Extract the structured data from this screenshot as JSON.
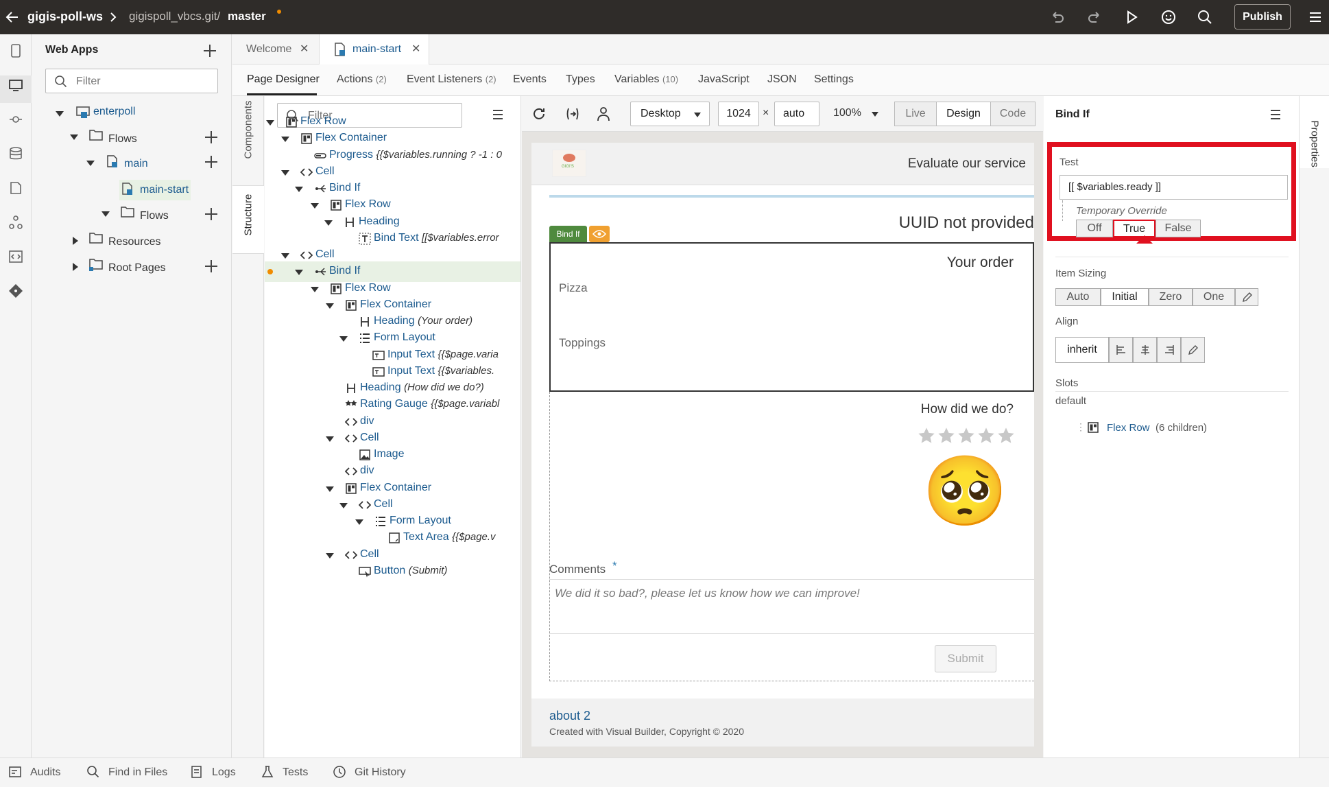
{
  "topbar": {
    "app_name": "gigis-poll-ws",
    "repo": "gigispoll_vbcs.git/",
    "branch": "master",
    "publish": "Publish"
  },
  "apps_panel": {
    "title": "Web Apps",
    "filter_placeholder": "Filter",
    "nodes": {
      "app": "enterpoll",
      "flows": "Flows",
      "main": "main",
      "main_start": "main-start",
      "subflows": "Flows",
      "resources": "Resources",
      "root_pages": "Root Pages"
    }
  },
  "tabs": {
    "welcome": "Welcome",
    "main_start": "main-start"
  },
  "subtabs": {
    "page_designer": "Page Designer",
    "actions": "Actions",
    "actions_count": "(2)",
    "event_listeners": "Event Listeners",
    "event_listeners_count": "(2)",
    "events": "Events",
    "types": "Types",
    "variables": "Variables",
    "variables_count": "(10)",
    "javascript": "JavaScript",
    "json": "JSON",
    "settings": "Settings"
  },
  "side_tabs": {
    "components": "Components",
    "structure": "Structure"
  },
  "tree": {
    "filter_placeholder": "Filter",
    "rows": [
      {
        "name": "Flex Row",
        "detail": ""
      },
      {
        "name": "Flex Container",
        "detail": ""
      },
      {
        "name": "Progress",
        "detail": "{{$variables.running ? -1 : 0"
      },
      {
        "name": "Cell",
        "detail": ""
      },
      {
        "name": "Bind If",
        "detail": ""
      },
      {
        "name": "Flex Row",
        "detail": ""
      },
      {
        "name": "Heading",
        "detail": ""
      },
      {
        "name": "Bind Text",
        "detail": "[[$variables.error"
      },
      {
        "name": "Cell",
        "detail": ""
      },
      {
        "name": "Bind If",
        "detail": ""
      },
      {
        "name": "Flex Row",
        "detail": ""
      },
      {
        "name": "Flex Container",
        "detail": ""
      },
      {
        "name": "Heading",
        "detail": "(Your order)"
      },
      {
        "name": "Form Layout",
        "detail": ""
      },
      {
        "name": "Input Text",
        "detail": "{{$page.varia"
      },
      {
        "name": "Input Text",
        "detail": "{{$variables."
      },
      {
        "name": "Heading",
        "detail": "(How did we do?)"
      },
      {
        "name": "Rating Gauge",
        "detail": "{{$page.variabl"
      },
      {
        "name": "div",
        "detail": ""
      },
      {
        "name": "Cell",
        "detail": ""
      },
      {
        "name": "Image",
        "detail": ""
      },
      {
        "name": "div",
        "detail": ""
      },
      {
        "name": "Flex Container",
        "detail": ""
      },
      {
        "name": "Cell",
        "detail": ""
      },
      {
        "name": "Form Layout",
        "detail": ""
      },
      {
        "name": "Text Area",
        "detail": "{{$page.v"
      },
      {
        "name": "Cell",
        "detail": ""
      },
      {
        "name": "Button",
        "detail": "(Submit)"
      }
    ]
  },
  "canvas_toolbar": {
    "device": "Desktop",
    "width": "1024",
    "times": "×",
    "height": "auto",
    "zoom": "100%",
    "modes": [
      "Live",
      "Design",
      "Code"
    ]
  },
  "page_preview": {
    "logo_text": "GIGI'S",
    "header_title": "Evaluate our service",
    "uuid_heading": "UUID not provided",
    "bind_if_badge": "Bind If",
    "your_order": "Your order",
    "pizza_label": "Pizza",
    "toppings_label": "Toppings",
    "how_did_we_do": "How did we do?",
    "rating_value": 0,
    "rating_max": 5,
    "emoji": "🥺",
    "comments_label": "Comments",
    "required_mark": "*",
    "comments_placeholder": "We did it so bad?, please let us know how we can improve!",
    "submit": "Submit",
    "footer_link": "about 2",
    "footer_copyright": "Created with Visual Builder, Copyright © 2020"
  },
  "properties": {
    "title": "Bind If",
    "side_label": "Properties",
    "test_label": "Test",
    "test_value": "[[ $variables.ready ]]",
    "override_label": "Temporary Override",
    "override_options": [
      "Off",
      "True",
      "False"
    ],
    "override_selected": "True",
    "item_sizing_label": "Item Sizing",
    "item_sizing_options": [
      "Auto",
      "Initial",
      "Zero",
      "One"
    ],
    "item_sizing_selected": "Initial",
    "align_label": "Align",
    "align_value": "inherit",
    "slots_label": "Slots",
    "slot_default": "default",
    "slot_child": "Flex Row",
    "slot_child_detail": "(6 children)",
    "highlight_color": "#e0101f"
  },
  "bottom_bar": [
    "Audits",
    "Find in Files",
    "Logs",
    "Tests",
    "Git History"
  ]
}
